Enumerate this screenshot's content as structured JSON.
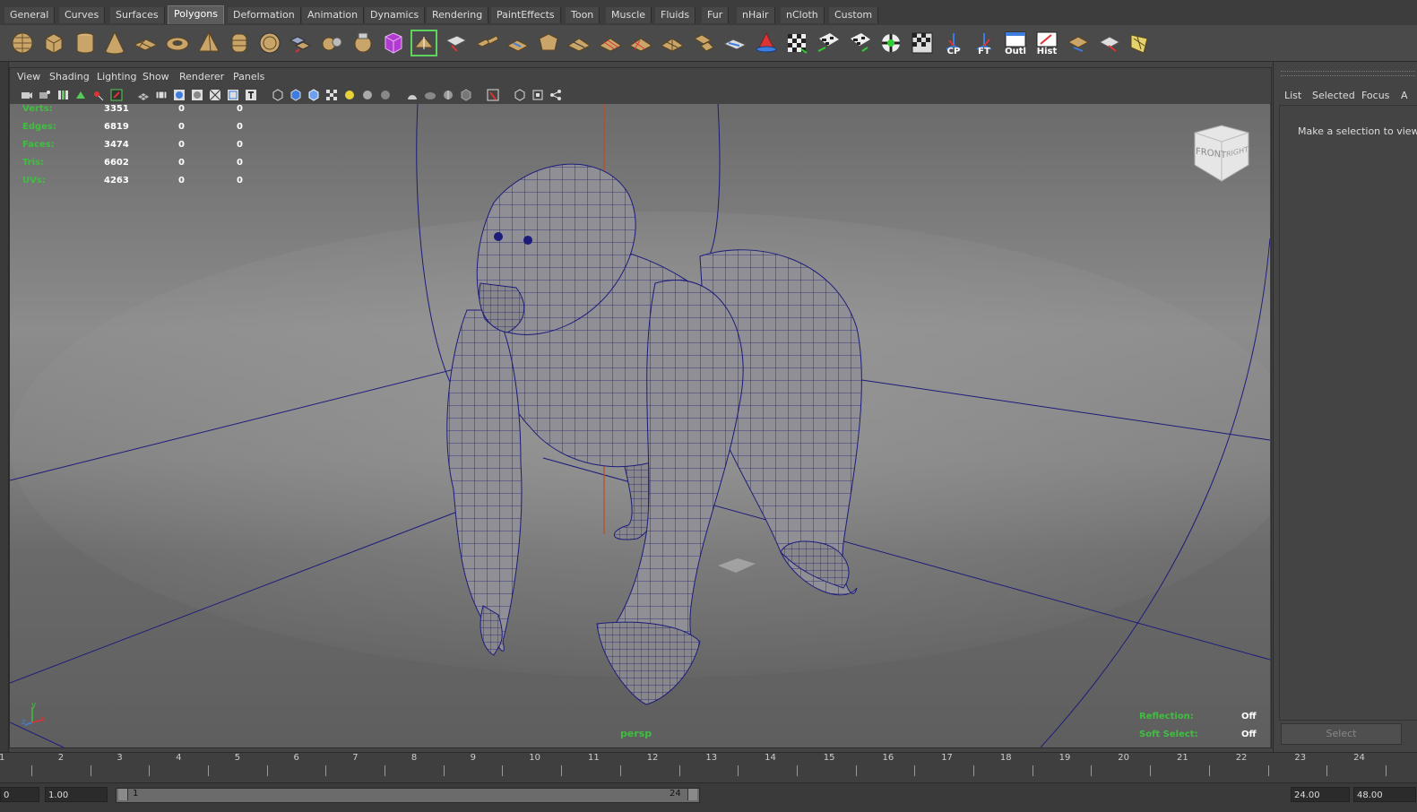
{
  "shelf": {
    "tabs": [
      "General",
      "Curves",
      "Surfaces",
      "Polygons",
      "Deformation",
      "Animation",
      "Dynamics",
      "Rendering",
      "PaintEffects",
      "Toon",
      "Muscle",
      "Fluids",
      "Fur",
      "nHair",
      "nCloth",
      "Custom"
    ],
    "active_tab": "Polygons",
    "icon_labels": {
      "cp": "CP",
      "ft": "FT",
      "outl": "Outl",
      "hist": "Hist"
    }
  },
  "panel": {
    "menu": [
      "View",
      "Shading",
      "Lighting",
      "Show",
      "Renderer",
      "Panels"
    ]
  },
  "hud": {
    "rows": [
      {
        "label": "Verts:",
        "a": "3351",
        "b": "0",
        "c": "0"
      },
      {
        "label": "Edges:",
        "a": "6819",
        "b": "0",
        "c": "0"
      },
      {
        "label": "Faces:",
        "a": "3474",
        "b": "0",
        "c": "0"
      },
      {
        "label": "Tris:",
        "a": "6602",
        "b": "0",
        "c": "0"
      },
      {
        "label": "UVs:",
        "a": "4263",
        "b": "0",
        "c": "0"
      }
    ],
    "camera": "persp",
    "reflection_label": "Reflection:",
    "reflection_value": "Off",
    "soft_select_label": "Soft Select:",
    "soft_select_value": "Off",
    "viewcube_front": "FRONT",
    "viewcube_right": "RIGHT",
    "axis_x": "x",
    "axis_y": "y",
    "axis_z": "z"
  },
  "right_panel": {
    "tabs": [
      "List",
      "Selected",
      "Focus",
      "A"
    ],
    "message": "Make a selection to view a",
    "select_button": "Select"
  },
  "timeline": {
    "frames": [
      "1",
      "2",
      "3",
      "4",
      "5",
      "6",
      "7",
      "8",
      "9",
      "10",
      "11",
      "12",
      "13",
      "14",
      "15",
      "16",
      "17",
      "18",
      "19",
      "20",
      "21",
      "22",
      "23",
      "24"
    ]
  },
  "range": {
    "start_field": "0",
    "current_field": "1.00",
    "slider_start": "1",
    "slider_end": "24",
    "end_field": "24.00",
    "max_field": "48.00"
  },
  "colors": {
    "hud_green": "#3fbf3f",
    "wire_blue": "#1c1c7a",
    "active_green": "#5fd35f"
  }
}
